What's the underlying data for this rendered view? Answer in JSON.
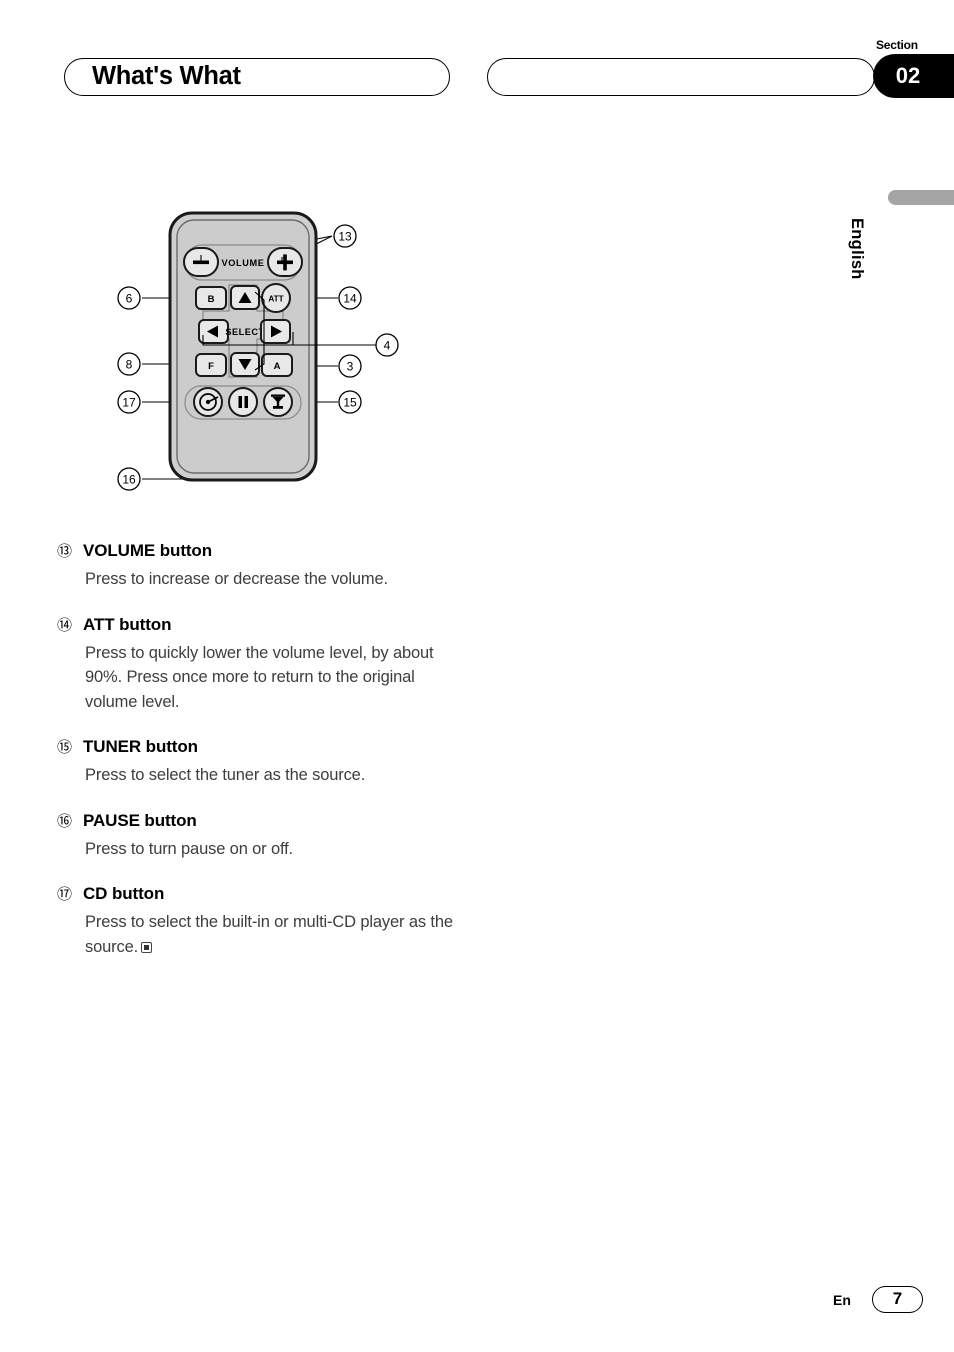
{
  "header": {
    "title": "What's What",
    "secondary_box": "",
    "section_label": "Section",
    "section_number": "02"
  },
  "side_tab": {
    "language": "English"
  },
  "figure": {
    "name": "remote-control-diagram",
    "device_label_volume": "VOLUME",
    "device_label_select": "SELECT",
    "buttons": [
      {
        "id": "volume-minus",
        "label": "−"
      },
      {
        "id": "volume-plus",
        "label": "+"
      },
      {
        "id": "band-b",
        "label": "B"
      },
      {
        "id": "att",
        "label": "ATT"
      },
      {
        "id": "up",
        "label": "▲"
      },
      {
        "id": "left",
        "label": "◀"
      },
      {
        "id": "right",
        "label": "▶"
      },
      {
        "id": "down",
        "label": "▼"
      },
      {
        "id": "function-f",
        "label": "F"
      },
      {
        "id": "audio-a",
        "label": "A"
      },
      {
        "id": "cd",
        "label": "cd-disc-icon"
      },
      {
        "id": "pause",
        "label": "pause-icon"
      },
      {
        "id": "tuner",
        "label": "tuner-antenna-icon"
      }
    ],
    "callouts": [
      {
        "id": "callout-13",
        "label": "13"
      },
      {
        "id": "callout-6",
        "label": "6"
      },
      {
        "id": "callout-14",
        "label": "14"
      },
      {
        "id": "callout-8",
        "label": "8"
      },
      {
        "id": "callout-4",
        "label": "4"
      },
      {
        "id": "callout-3",
        "label": "3"
      },
      {
        "id": "callout-17",
        "label": "17"
      },
      {
        "id": "callout-15",
        "label": "15"
      },
      {
        "id": "callout-16",
        "label": "16"
      }
    ]
  },
  "entries": [
    {
      "num": "⑬",
      "title": "VOLUME button",
      "desc": "Press to increase or decrease the volume.",
      "end_mark": false
    },
    {
      "num": "⑭",
      "title": "ATT button",
      "desc": "Press to quickly lower the volume level, by about 90%. Press once more to return to the original volume level.",
      "end_mark": false
    },
    {
      "num": "⑮",
      "title": "TUNER button",
      "desc": "Press to select the tuner as the source.",
      "end_mark": false
    },
    {
      "num": "⑯",
      "title": "PAUSE button",
      "desc": "Press to turn pause on or off.",
      "end_mark": false
    },
    {
      "num": "⑰",
      "title": "CD button",
      "desc": "Press to select the built-in or multi-CD player as the source.",
      "end_mark": true
    }
  ],
  "footer": {
    "language_code": "En",
    "page_number": "7"
  },
  "colors": {
    "remote_body": "#c8c8c8",
    "remote_outline": "#1a1a1a",
    "button_face": "#e6e6e6",
    "side_tab": "#a5a5a5",
    "badge": "#000000"
  }
}
